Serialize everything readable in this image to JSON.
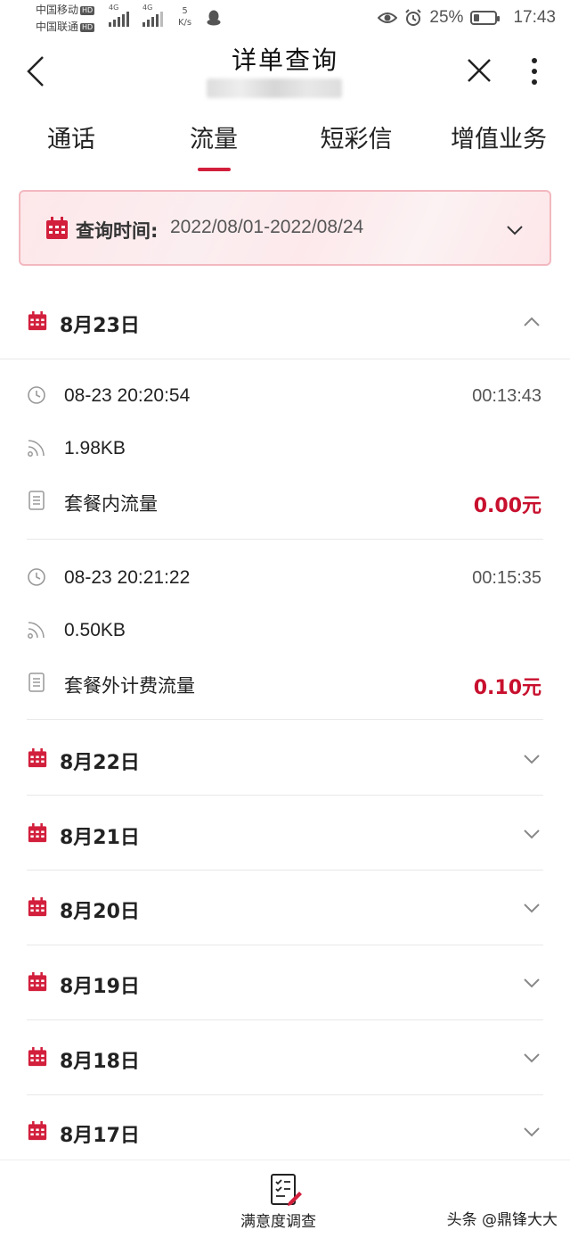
{
  "status_bar": {
    "carrier1": "中国移动",
    "carrier2": "中国联通",
    "hd": "HD",
    "net_type": "4G",
    "speed_value": "5",
    "speed_unit": "K/s",
    "battery": "25%",
    "battery_level": 0.25,
    "time": "17:43"
  },
  "header": {
    "title": "详单查询",
    "back_icon": "back-icon",
    "close_icon": "close-icon",
    "more_icon": "more-icon"
  },
  "tabs": [
    {
      "label": "通话",
      "active": false
    },
    {
      "label": "流量",
      "active": true
    },
    {
      "label": "短彩信",
      "active": false
    },
    {
      "label": "增值业务",
      "active": false
    }
  ],
  "query": {
    "label": "查询时间:",
    "value": "2022/08/01-2022/08/24"
  },
  "expanded_day": {
    "date": "8月23日",
    "records": [
      {
        "time": "08-23 20:20:54",
        "duration": "00:13:43",
        "usage": "1.98KB",
        "type": "套餐内流量",
        "fee": "0.00元"
      },
      {
        "time": "08-23 20:21:22",
        "duration": "00:15:35",
        "usage": "0.50KB",
        "type": "套餐外计费流量",
        "fee": "0.10元"
      }
    ]
  },
  "collapsed_days": [
    "8月22日",
    "8月21日",
    "8月20日",
    "8月19日",
    "8月18日",
    "8月17日"
  ],
  "bottom": {
    "survey_label": "满意度调查",
    "watermark": "头条 @鼎锋大大"
  },
  "colors": {
    "accent": "#d21f3c",
    "price": "#c8102e"
  }
}
